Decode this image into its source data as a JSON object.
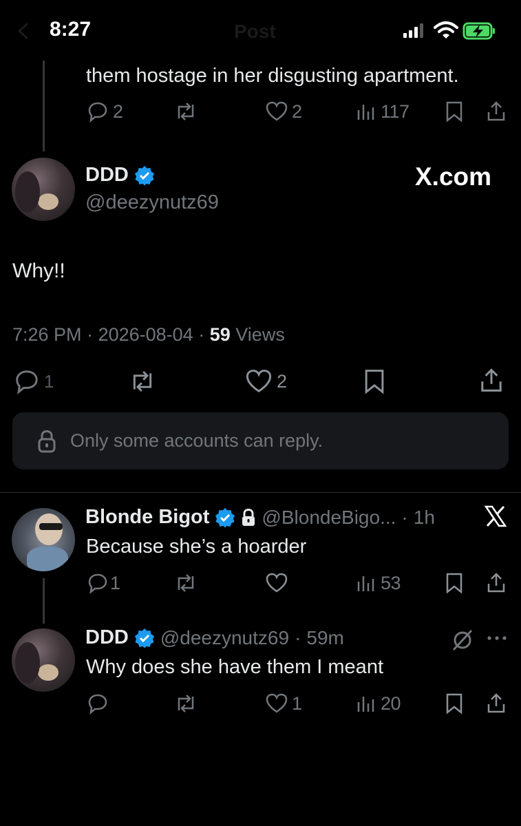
{
  "status_bar": {
    "time": "8:27",
    "header_title": "Post"
  },
  "parent_tweet": {
    "text": "them hostage in her disgusting apartment.",
    "replies": "2",
    "likes": "2",
    "views": "117"
  },
  "main_tweet": {
    "name": "DDD",
    "handle": "@deezynutz69",
    "watermark": "X.com",
    "text": "Why!!",
    "time": "7:26 PM",
    "date": "2026-08-04",
    "views_count": "59",
    "views_label": "Views",
    "replies": "1",
    "likes": "2",
    "reply_restriction": "Only some accounts can reply."
  },
  "reply1": {
    "name": "Blonde Bigot",
    "handle": "@BlondeBigo...",
    "age": "1h",
    "text": "Because she’s a hoarder",
    "replies": "1",
    "views": "53"
  },
  "reply2": {
    "name": "DDD",
    "handle": "@deezynutz69",
    "age": "59m",
    "text": "Why does she have them I meant",
    "likes": "1",
    "views": "20"
  },
  "colors": {
    "verified": "#1d9bf0",
    "battery": "#4cd964",
    "background": "#000000"
  }
}
